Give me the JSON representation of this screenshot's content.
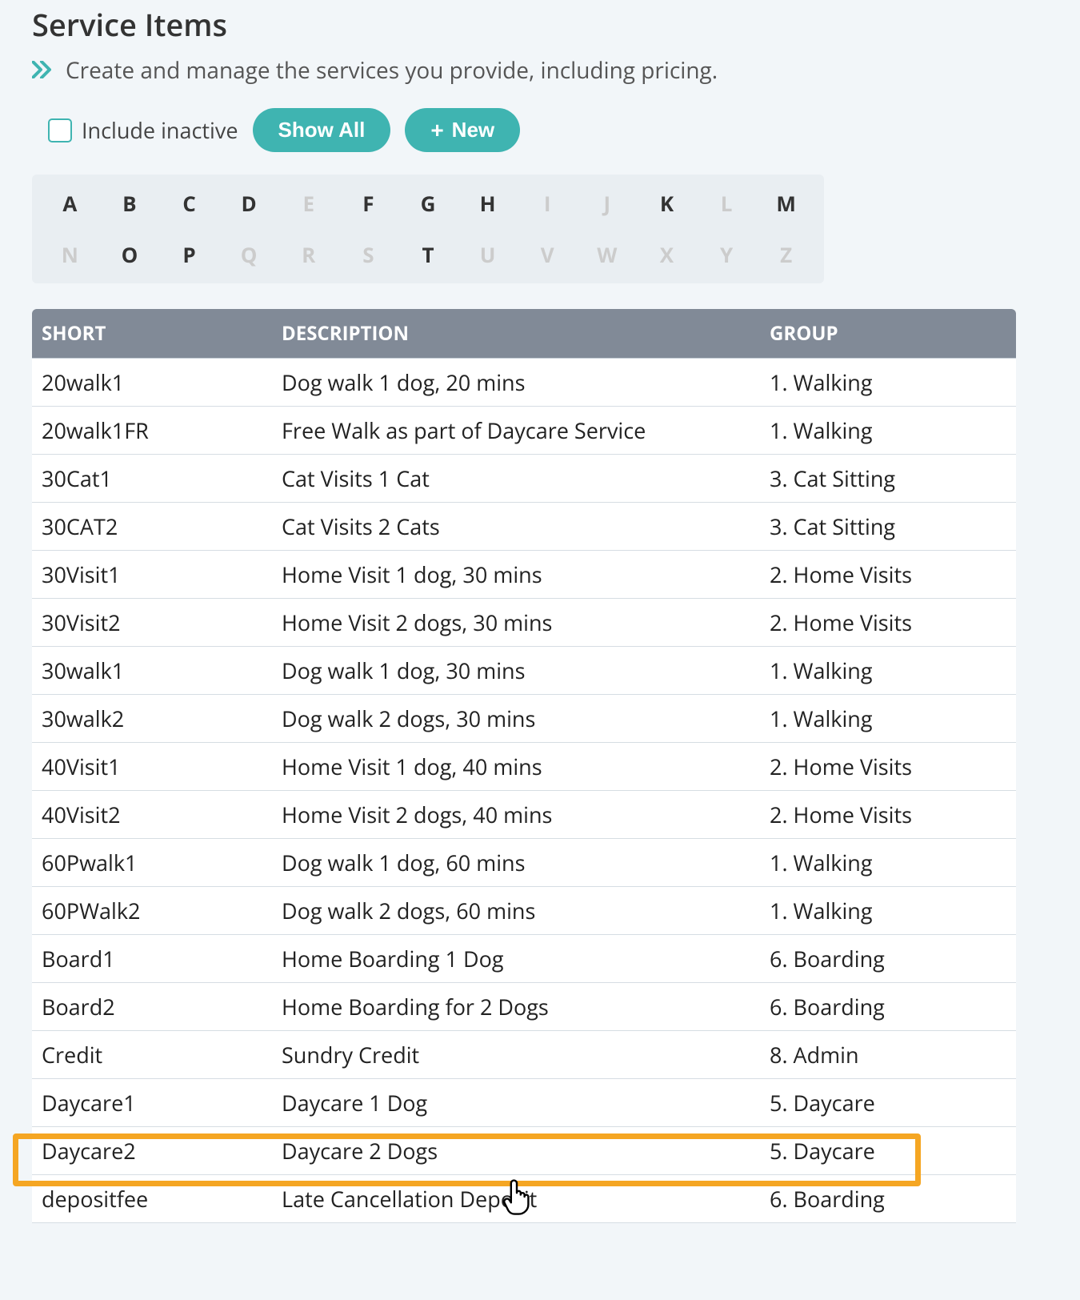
{
  "title": "Service Items",
  "subtitle": "Create and manage the services you provide, including pricing.",
  "controls": {
    "include_inactive_label": "Include inactive",
    "show_all_label": "Show All",
    "new_label": "New"
  },
  "alpha": [
    {
      "l": "A",
      "a": true
    },
    {
      "l": "B",
      "a": true
    },
    {
      "l": "C",
      "a": true
    },
    {
      "l": "D",
      "a": true
    },
    {
      "l": "E",
      "a": false
    },
    {
      "l": "F",
      "a": true
    },
    {
      "l": "G",
      "a": true
    },
    {
      "l": "H",
      "a": true
    },
    {
      "l": "I",
      "a": false
    },
    {
      "l": "J",
      "a": false
    },
    {
      "l": "K",
      "a": true
    },
    {
      "l": "L",
      "a": false
    },
    {
      "l": "M",
      "a": true
    },
    {
      "l": "N",
      "a": false
    },
    {
      "l": "O",
      "a": true
    },
    {
      "l": "P",
      "a": true
    },
    {
      "l": "Q",
      "a": false
    },
    {
      "l": "R",
      "a": false
    },
    {
      "l": "S",
      "a": false
    },
    {
      "l": "T",
      "a": true
    },
    {
      "l": "U",
      "a": false
    },
    {
      "l": "V",
      "a": false
    },
    {
      "l": "W",
      "a": false
    },
    {
      "l": "X",
      "a": false
    },
    {
      "l": "Y",
      "a": false
    },
    {
      "l": "Z",
      "a": false
    }
  ],
  "columns": {
    "short": "SHORT",
    "description": "DESCRIPTION",
    "group": "GROUP"
  },
  "rows": [
    {
      "short": "20walk1",
      "desc": "Dog walk 1 dog, 20 mins",
      "group": "1. Walking"
    },
    {
      "short": "20walk1FR",
      "desc": "Free Walk as part of Daycare Service",
      "group": "1. Walking"
    },
    {
      "short": "30Cat1",
      "desc": "Cat Visits 1 Cat",
      "group": "3. Cat Sitting"
    },
    {
      "short": "30CAT2",
      "desc": "Cat Visits 2 Cats",
      "group": "3. Cat Sitting"
    },
    {
      "short": "30Visit1",
      "desc": "Home Visit 1 dog, 30 mins",
      "group": "2. Home Visits"
    },
    {
      "short": "30Visit2",
      "desc": "Home Visit 2 dogs, 30 mins",
      "group": "2. Home Visits"
    },
    {
      "short": "30walk1",
      "desc": "Dog walk 1 dog, 30 mins",
      "group": "1. Walking"
    },
    {
      "short": "30walk2",
      "desc": "Dog walk 2 dogs, 30 mins",
      "group": "1. Walking"
    },
    {
      "short": "40Visit1",
      "desc": "Home Visit 1 dog, 40 mins",
      "group": "2. Home Visits"
    },
    {
      "short": "40Visit2",
      "desc": "Home Visit 2 dogs, 40 mins",
      "group": "2. Home Visits"
    },
    {
      "short": "60Pwalk1",
      "desc": "Dog walk 1 dog, 60 mins",
      "group": "1. Walking"
    },
    {
      "short": "60PWalk2",
      "desc": "Dog walk 2 dogs, 60 mins",
      "group": "1. Walking"
    },
    {
      "short": "Board1",
      "desc": "Home Boarding 1 Dog",
      "group": "6. Boarding"
    },
    {
      "short": "Board2",
      "desc": "Home Boarding for 2 Dogs",
      "group": "6. Boarding"
    },
    {
      "short": "Credit",
      "desc": "Sundry Credit",
      "group": "8. Admin"
    },
    {
      "short": "Daycare1",
      "desc": "Daycare 1 Dog",
      "group": "5. Daycare"
    },
    {
      "short": "Daycare2",
      "desc": "Daycare 2 Dogs",
      "group": "5. Daycare"
    },
    {
      "short": "depositfee",
      "desc": "Late Cancellation Deposit",
      "group": "6. Boarding"
    }
  ],
  "highlight_row_index": 15
}
